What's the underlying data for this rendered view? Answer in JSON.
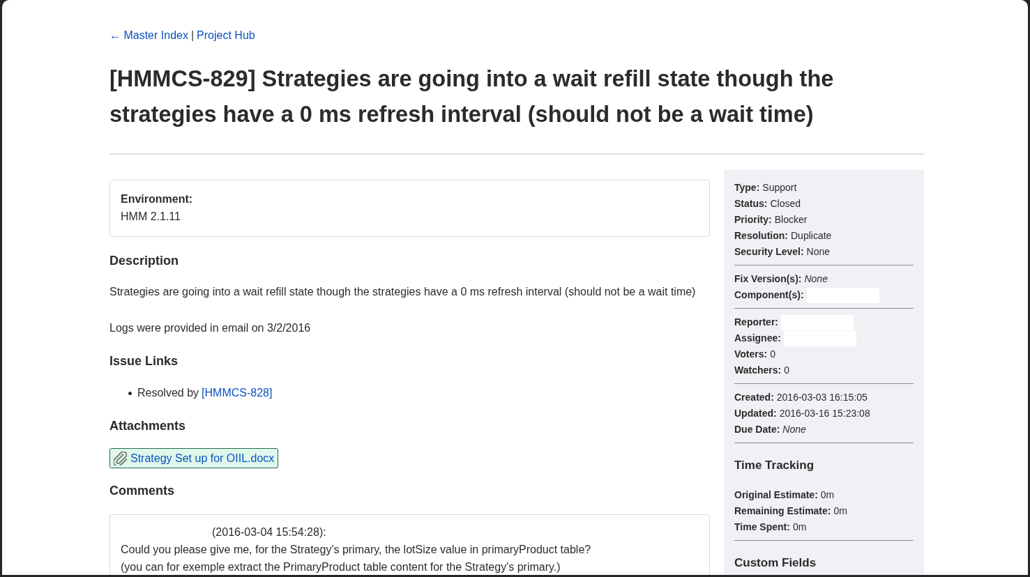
{
  "breadcrumb": {
    "links": [
      {
        "label": "← Master Index"
      },
      {
        "label": "Project Hub"
      }
    ],
    "separator": "|"
  },
  "title": "[HMMCS-829] Strategies are going into a wait refill state though the strategies have a 0 ms refresh interval (should not be a wait time)",
  "environment": {
    "label": "Environment:",
    "value": "HMM 2.1.11"
  },
  "description": {
    "heading": "Description",
    "paragraphs": [
      "Strategies are going into a wait refill state though the strategies have a 0 ms refresh interval (should not be a wait time)",
      "Logs were provided in email on 3/2/2016"
    ]
  },
  "issue_links": {
    "heading": "Issue Links",
    "items": [
      {
        "relation": "Resolved by",
        "key": "[HMMCS-828]"
      }
    ]
  },
  "attachments": {
    "heading": "Attachments",
    "files": [
      {
        "name": "Strategy Set up for OIIL.docx"
      }
    ]
  },
  "comments": {
    "heading": "Comments",
    "items": [
      {
        "timestamp": "(2016-03-04 15:54:28):",
        "lines": [
          "Could you please give me, for the Strategy's primary, the lotSize value in primaryProduct table?",
          "(you can for exemple extract the PrimaryProduct table content for the Strategy's primary.)"
        ]
      }
    ]
  },
  "sidebar": {
    "groups": [
      {
        "fields": [
          {
            "label": "Type:",
            "value": "Support",
            "kind": "plain"
          },
          {
            "label": "Status:",
            "value": "Closed",
            "kind": "plain"
          },
          {
            "label": "Priority:",
            "value": "Blocker",
            "kind": "plain"
          },
          {
            "label": "Resolution:",
            "value": "Duplicate",
            "kind": "plain"
          },
          {
            "label": "Security Level:",
            "value": "None",
            "kind": "plain"
          }
        ]
      },
      {
        "fields": [
          {
            "label": "Fix Version(s):",
            "value": "None",
            "kind": "italic"
          },
          {
            "label": "Component(s):",
            "kind": "redacted"
          }
        ]
      },
      {
        "fields": [
          {
            "label": "Reporter:",
            "kind": "redacted"
          },
          {
            "label": "Assignee:",
            "kind": "redacted"
          },
          {
            "label": "Voters:",
            "value": "0",
            "kind": "plain"
          },
          {
            "label": "Watchers:",
            "value": "0",
            "kind": "plain"
          }
        ]
      },
      {
        "fields": [
          {
            "label": "Created:",
            "value": "2016-03-03 16:15:05",
            "kind": "plain"
          },
          {
            "label": "Updated:",
            "value": "2016-03-16 15:23:08",
            "kind": "plain"
          },
          {
            "label": "Due Date:",
            "value": "None",
            "kind": "italic"
          }
        ]
      },
      {
        "heading": "Time Tracking",
        "fields": [
          {
            "label": "Original Estimate:",
            "value": "0m",
            "kind": "plain"
          },
          {
            "label": "Remaining Estimate:",
            "value": "0m",
            "kind": "plain"
          },
          {
            "label": "Time Spent:",
            "value": "0m",
            "kind": "plain"
          }
        ]
      },
      {
        "heading": "Custom Fields"
      }
    ]
  }
}
